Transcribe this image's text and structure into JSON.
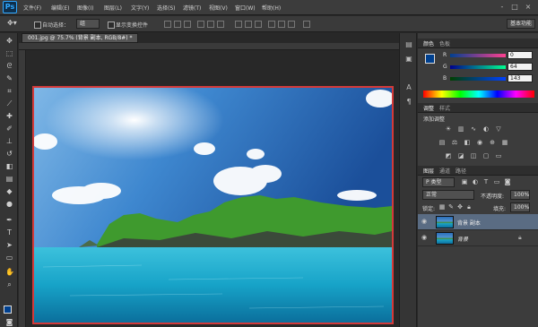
{
  "app": {
    "logo": "Ps",
    "window_controls": [
      "-",
      "□",
      "×"
    ]
  },
  "menu": [
    "文件(F)",
    "编辑(E)",
    "图像(I)",
    "图层(L)",
    "文字(Y)",
    "选择(S)",
    "滤镜(T)",
    "视图(V)",
    "窗口(W)",
    "帮助(H)"
  ],
  "options": {
    "auto_select_label": "自动选择：",
    "auto_select_value": "组",
    "show_transform_label": "显示变换控件",
    "workspace": "基本功能"
  },
  "document": {
    "tab_title": "001.jpg @ 75.7% (背景 副本, RGB/8#) *"
  },
  "tools": [
    "move-icon",
    "marquee-icon",
    "lasso-icon",
    "quick-select-icon",
    "crop-icon",
    "eyedropper-icon",
    "healing-icon",
    "brush-icon",
    "stamp-icon",
    "history-brush-icon",
    "eraser-icon",
    "gradient-icon",
    "blur-icon",
    "dodge-icon",
    "pen-icon",
    "type-icon",
    "path-select-icon",
    "shape-icon",
    "hand-icon",
    "zoom-icon"
  ],
  "color_panel": {
    "tabs": [
      "颜色",
      "色板"
    ],
    "channels": [
      {
        "label": "R",
        "value": "0"
      },
      {
        "label": "G",
        "value": "64"
      },
      {
        "label": "B",
        "value": "143"
      }
    ],
    "foreground": "#00408f"
  },
  "adjust_panel": {
    "tabs": [
      "调整",
      "样式"
    ],
    "title": "添加调整"
  },
  "layers_panel": {
    "tabs": [
      "图层",
      "通道",
      "路径"
    ],
    "filter_label": "P 类型",
    "blend_mode": "正常",
    "opacity_label": "不透明度:",
    "opacity_value": "100%",
    "lock_label": "锁定:",
    "fill_label": "填充:",
    "fill_value": "100%",
    "layers": [
      {
        "name": "背景 副本",
        "selected": true
      },
      {
        "name": "背景",
        "selected": false
      }
    ]
  }
}
